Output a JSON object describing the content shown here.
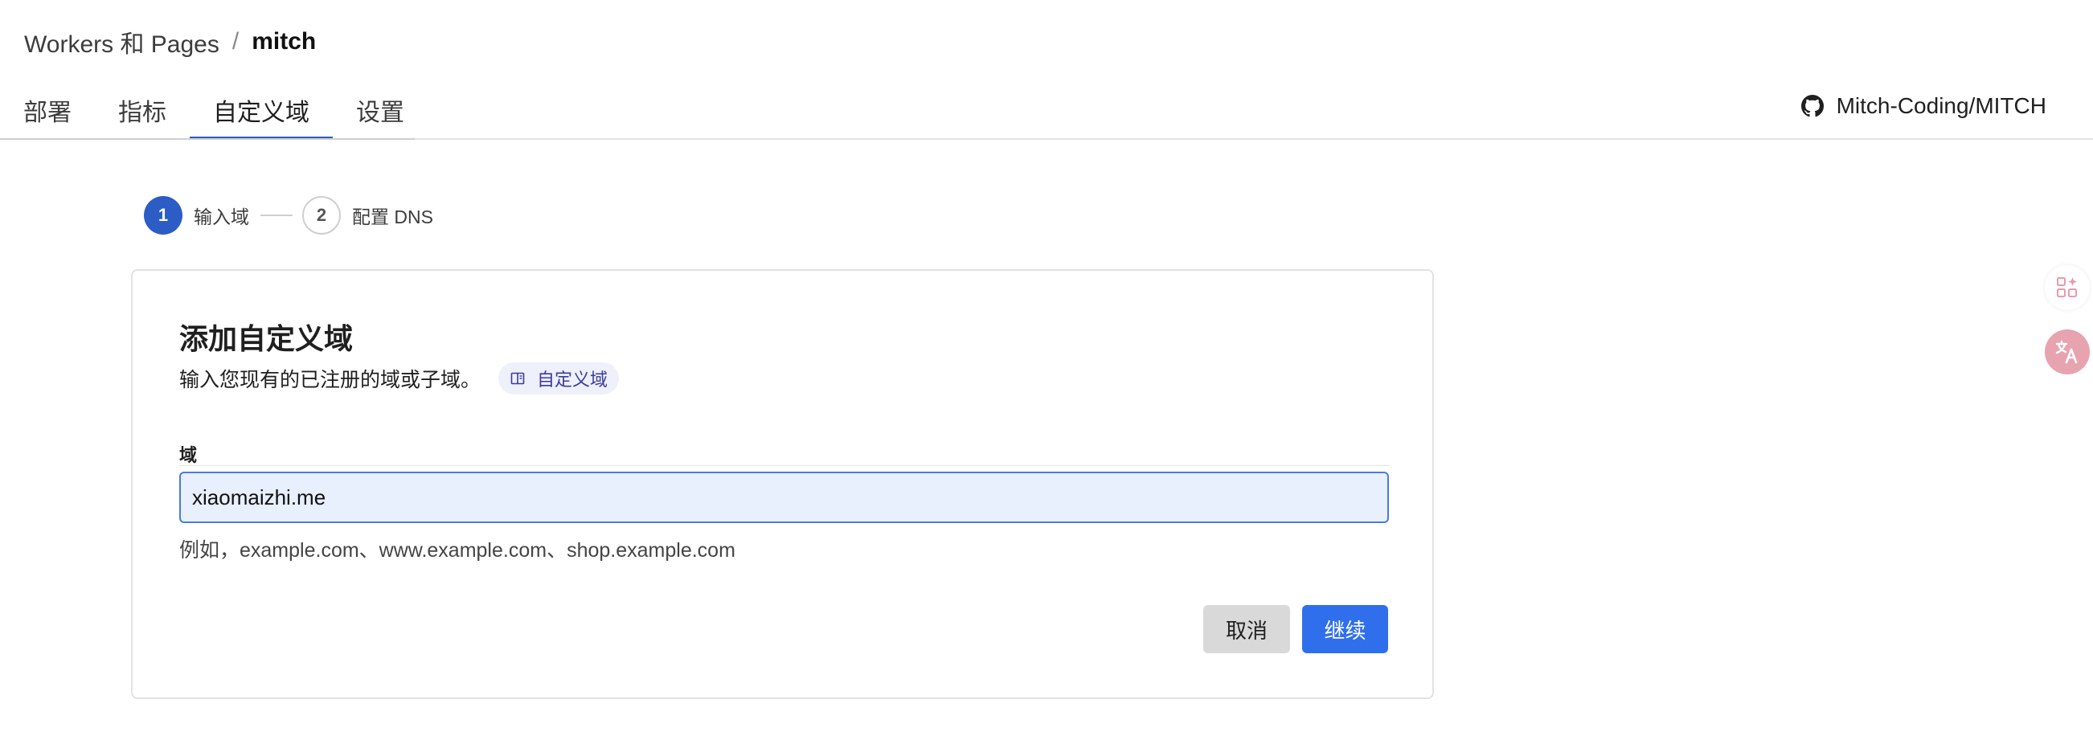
{
  "breadcrumb": {
    "parent": "Workers 和 Pages",
    "separator": "/",
    "current": "mitch"
  },
  "tabs": [
    {
      "label": "部署"
    },
    {
      "label": "指标"
    },
    {
      "label": "自定义域",
      "active": true
    },
    {
      "label": "设置"
    }
  ],
  "repo": {
    "label": "Mitch-Coding/MITCH",
    "icon": "github-icon"
  },
  "stepper": {
    "steps": [
      {
        "number": "1",
        "label": "输入域",
        "active": true
      },
      {
        "number": "2",
        "label": "配置 DNS",
        "active": false
      }
    ]
  },
  "card": {
    "title": "添加自定义域",
    "subtitle": "输入您现有的已注册的域或子域。",
    "doc_link": {
      "label": "自定义域",
      "icon": "book-icon"
    },
    "field": {
      "label": "域",
      "value": "xiaomaizhi.me",
      "help": "例如，example.com、www.example.com、shop.example.com"
    },
    "buttons": {
      "cancel": "取消",
      "continue": "继续"
    }
  },
  "side_widgets": [
    {
      "icon": "apps-icon"
    },
    {
      "icon": "translate-icon"
    }
  ],
  "colors": {
    "accent": "#2c5cc5",
    "primary_button": "#2f6fec",
    "input_bg": "#e8f0fe",
    "doc_pill_bg": "#eef0fa",
    "translate_widget": "#e7a3b0"
  }
}
